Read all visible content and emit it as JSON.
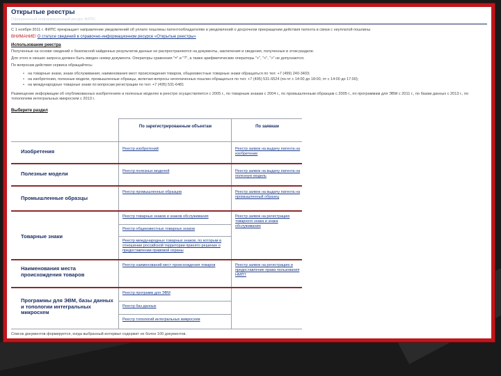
{
  "page": {
    "title": "Открытые реестры",
    "subtitle": "Официальный информационный ресурс ФИПС",
    "notice_line": "С 1 ноября 2011 г. ФИПС прекращает направление уведомлений об уплате пошлины патентообладателям и уведомлений о досрочном прекращении действия патента в связи с неуплатой пошлины",
    "warning_label": "ВНИМАНИЕ!",
    "warning_text": "О статусе сведений в справочно-информационном ресурсе «Открытые реестры»",
    "usage_heading": "Использование реестра",
    "usage_lines": [
      "Полученные на основе сведений о безопасной найденных результатов данные не распространяются на документы, заключения и сведения, полученные в этом разделе.",
      "Для этого в окошко запроса должен быть введен номер документа. Операторы сравнения \"=\" и \"?\", а также арифметические операторы \"+\", \"<\", \">\" не допускаются.",
      "По вопросам действия сервиса обращайтесь:"
    ],
    "contact_bullets": [
      "на товарные знаки, знаки обслуживания, наименования мест происхождения товаров, общеизвестные товарные знаки обращаться по тел: +7 (499) 240-3403;",
      "на изобретения, полезные модели, промышленные образцы, включая вопросы неоплаченных пошлин обращаться по тел: +7 (495) 531-6524 (пн-чт с 14:00 до 18:00, пт с 14:00 до 17:00);",
      "на международные товарные знаки по вопросам регистрации по тел: +7 (495) 531-6481"
    ],
    "info_para": "Размещение информации об опубликованных изобретениях и полезных моделях в реестре осуществляется с 2005 г., по товарным знакам с 2004 г., по промышленным образцам с 2005 г., по программам для ЭВМ с 2011 г., по базам данных с 2013 г., по топологиям интегральных микросхем с 2013 г.",
    "choose_section": "Выберите раздел",
    "footer_note": "Список документов формируется, когда выбранный интервал содержит не более 100 документов."
  },
  "table": {
    "col_headers": [
      "По зарегистрированным объектам",
      "По заявкам"
    ],
    "rows": [
      {
        "category": "Изобретения",
        "registered": [
          "Реестр изобретений"
        ],
        "applications": [
          "Реестр заявок на выдачу патента на изобретение"
        ]
      },
      {
        "category": "Полезные модели",
        "registered": [
          "Реестр полезных моделей"
        ],
        "applications": [
          "Реестр заявок на выдачу патента на полезную модель"
        ]
      },
      {
        "category": "Промышленные образцы",
        "registered": [
          "Реестр промышленных образцов"
        ],
        "applications": [
          "Реестр заявок на выдачу патента на промышленный образец"
        ]
      },
      {
        "category": "Товарные знаки",
        "registered": [
          "Реестр товарных знаков и знаков обслуживания",
          "Реестр общеизвестных товарных знаков",
          "Реестр международных товарных знаков, по которым в отношении российской территории принято решение о предоставлении правовой охраны"
        ],
        "applications": [
          "Реестр заявок на регистрацию товарного знака и знака обслуживания"
        ]
      },
      {
        "category": "Наименования места происхождения товаров",
        "registered": [
          "Реестр наименований мест происхождения товаров"
        ],
        "applications": [
          "Реестр заявок на регистрацию и предоставление права пользования НМПТ"
        ]
      },
      {
        "category": "Программы для ЭВМ, базы данных и топологии интегральных микросхем",
        "registered": [
          "Реестр программ для ЭВМ",
          "Реестр баз данных",
          "Реестр топологий интегральных микросхем"
        ],
        "applications": []
      }
    ]
  },
  "colors": {
    "frame": "#c0161c",
    "background": "#1a1a1a",
    "heading_blue": "#1b2e63",
    "link_blue": "#1d3d8a"
  }
}
